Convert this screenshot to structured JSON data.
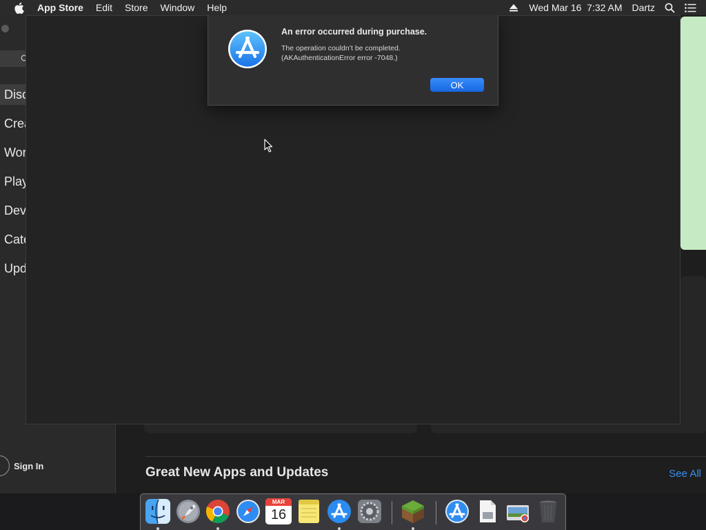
{
  "menubar": {
    "app_name": "App Store",
    "items": [
      "Edit",
      "Store",
      "Window",
      "Help"
    ],
    "clock": "Wed Mar 16  7:32 AM",
    "user": "Dartz"
  },
  "sidebar": {
    "items": [
      {
        "label": "Disc",
        "active": true
      },
      {
        "label": "Crea"
      },
      {
        "label": "Wor"
      },
      {
        "label": "Play"
      },
      {
        "label": "Dev"
      },
      {
        "label": "Cate"
      },
      {
        "label": "Upd"
      }
    ],
    "sign_in": "Sign In"
  },
  "main": {
    "section_title": "Great New Apps and Updates",
    "see_all": "See All"
  },
  "alert": {
    "title": "An error occurred during purchase.",
    "message_line1": "The operation couldn’t be completed.",
    "message_line2": "(AKAuthenticationError error -7048.)",
    "ok_label": "OK"
  },
  "dock": {
    "calendar_month": "MAR",
    "calendar_day": "16",
    "apps": [
      "Finder",
      "Launchpad",
      "Google Chrome",
      "Safari",
      "Calendar",
      "Notes",
      "App Store",
      "System Preferences",
      "Minecraft",
      "App Store Installer",
      "Preview",
      "Downloads",
      "Trash"
    ]
  },
  "colors": {
    "accent": "#1666e0",
    "link": "#3b8ff0",
    "banner": "#c6ebc4"
  }
}
